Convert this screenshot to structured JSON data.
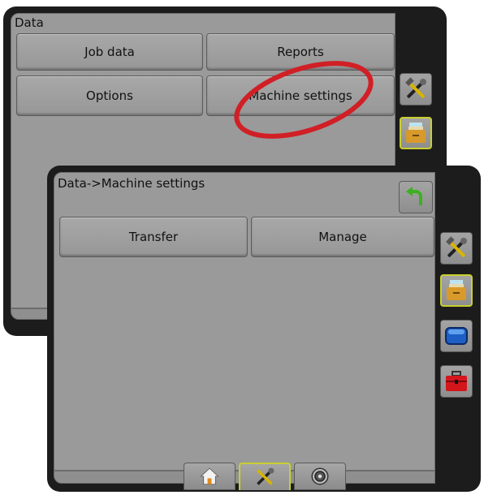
{
  "back_screen": {
    "title": "Data",
    "buttons": [
      "Job data",
      "Reports",
      "Options",
      "Machine settings"
    ],
    "side_icons": [
      "tools-icon",
      "data-drawer-icon"
    ]
  },
  "front_screen": {
    "title": "Data->Machine settings",
    "buttons": [
      "Transfer",
      "Manage"
    ],
    "back_icon": "return-arrow-icon",
    "side_icons": [
      "tools-icon",
      "data-drawer-icon",
      "display-icon",
      "toolbox-icon"
    ],
    "bottom_tabs": [
      "home-icon",
      "tools-icon",
      "guidance-icon"
    ],
    "selected_side": "data-drawer-icon",
    "selected_tab": "tools-icon"
  },
  "colors": {
    "highlight": "#d11f26",
    "selected_border": "#c9cf2e",
    "panel": "#9a9a9a",
    "bezel": "#1c1c1c"
  }
}
